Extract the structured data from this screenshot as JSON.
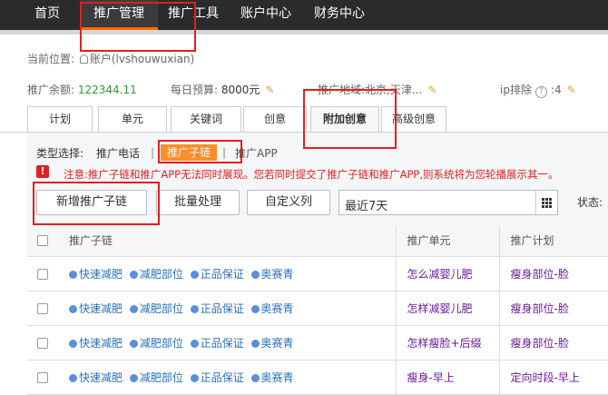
{
  "nav": {
    "items": [
      "首页",
      "推广管理",
      "推广工具",
      "账户中心",
      "财务中心"
    ],
    "active_index": 1
  },
  "breadcrumb": {
    "label": "当前位置:",
    "account": "账户(lvshouwuxian)"
  },
  "info": {
    "balance_label": "推广余额:",
    "balance_value": "122344.11",
    "budget_label": "每日预算:",
    "budget_value": "8000元",
    "region_label": "推广地域:",
    "region_value": "北京,天津...",
    "ip_label": "ip排除",
    "ip_value": ":4"
  },
  "tabs": [
    "计划",
    "单元",
    "关键词",
    "创意",
    "附加创意",
    "高级创意"
  ],
  "active_tab": "附加创意",
  "type_select": {
    "label": "类型选择:",
    "options": [
      "推广电话",
      "推广子链",
      "推广APP"
    ],
    "selected": "推广子链"
  },
  "warning": "注意:推广子链和推广APP无法同时展现。您若同时提交了推广子链和推广APP,则系统将为您轮播展示其一。",
  "toolbar": {
    "add": "新增推广子链",
    "batch": "批量处理",
    "columns": "自定义列",
    "date_range": "最近7天",
    "status_label": "状态:"
  },
  "table": {
    "headers": [
      "推广子链",
      "推广单元",
      "推广计划"
    ],
    "rows": [
      {
        "links": [
          "快速减肥",
          "减肥部位",
          "正品保证",
          "奥赛青"
        ],
        "unit": "怎么减婴儿肥",
        "plan": "瘦身部位-脸"
      },
      {
        "links": [
          "快速减肥",
          "减肥部位",
          "正品保证",
          "奥赛青"
        ],
        "unit": "怎样减婴儿肥",
        "plan": "瘦身部位-脸"
      },
      {
        "links": [
          "快速减肥",
          "减肥部位",
          "正品保证",
          "奥赛青"
        ],
        "unit": "怎样瘦脸+后缀",
        "plan": "瘦身部位-脸"
      },
      {
        "links": [
          "快速减肥",
          "减肥部位",
          "正品保证",
          "奥赛青"
        ],
        "unit": "瘦身-早上",
        "plan": "定向时段-早上"
      }
    ]
  },
  "colors": {
    "nav_bg": "#2b2b2b",
    "accent": "#ff8c2a",
    "warning": "#e02020",
    "link": "#2a6fbf",
    "unit_text": "#6a1b9a"
  }
}
